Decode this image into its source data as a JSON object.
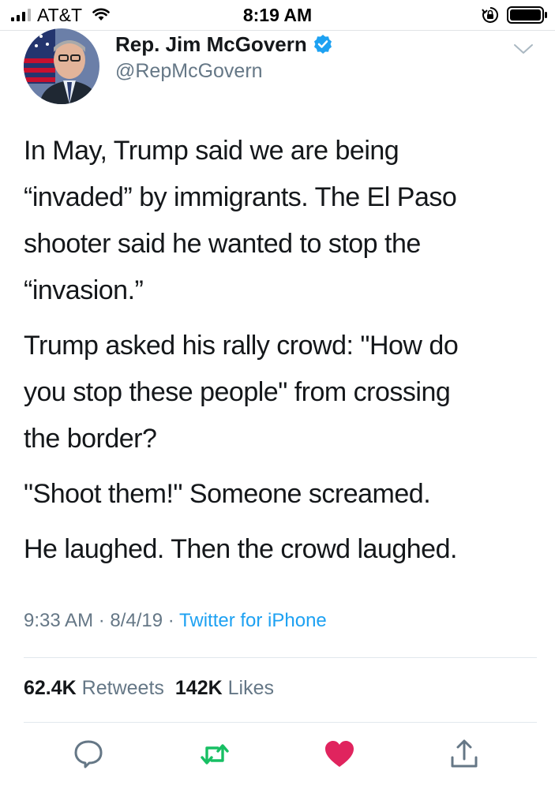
{
  "status_bar": {
    "carrier": "AT&T",
    "time": "8:19 AM",
    "icons": [
      "signal-icon",
      "wifi-icon",
      "orientation-lock-icon",
      "battery-icon"
    ]
  },
  "tweet": {
    "author": {
      "display_name": "Rep. Jim McGovern",
      "handle": "@RepMcGovern",
      "verified": true
    },
    "paragraphs": [
      "In May, Trump said we are being\n“invaded” by immigrants. The El Paso\nshooter said he wanted to stop the\n“invasion.”",
      "Trump asked his rally crowd: \"How do\nyou stop these people\" from crossing\nthe border?",
      "\"Shoot them!\" Someone screamed.",
      "He laughed. Then the crowd laughed."
    ],
    "time": "9:33 AM",
    "date": "8/4/19",
    "separator": " · ",
    "source": "Twitter for iPhone",
    "stats": {
      "retweets_count": "62.4K",
      "retweets_label": "Retweets",
      "likes_count": "142K",
      "likes_label": "Likes"
    }
  },
  "actions": [
    "reply-icon",
    "retweet-icon",
    "like-icon",
    "share-icon"
  ],
  "colors": {
    "text": "#14171a",
    "secondary": "#657786",
    "link": "#1da1f2",
    "retweet_green": "#17bf63",
    "like_red": "#e0245e"
  }
}
